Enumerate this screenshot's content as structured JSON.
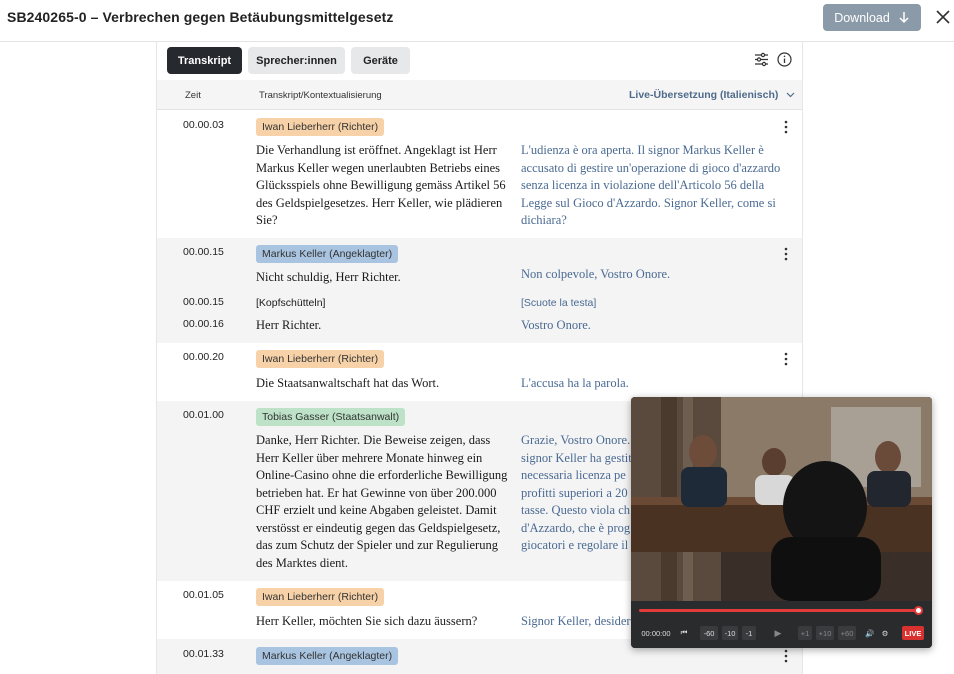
{
  "header": {
    "title": "SB240265-0 – Verbrechen gegen Betäubungsmittelgesetz",
    "download_label": "Download"
  },
  "tabs": [
    {
      "label": "Transkript",
      "active": true
    },
    {
      "label": "Sprecher:innen",
      "active": false
    },
    {
      "label": "Geräte",
      "active": false
    }
  ],
  "columns": {
    "time": "Zeit",
    "transcript": "Transkript/Kontextualisierung",
    "translation": "Live-Übersetzung (Italienisch)"
  },
  "entries": [
    {
      "time": "00.00.03",
      "speaker": "Iwan Lieberherr (Richter)",
      "speaker_color": "#f7d2a8",
      "de": "Die Verhandlung ist eröffnet. Angeklagt ist Herr Markus Keller wegen unerlaubten Betriebs eines Glücksspiels ohne Bewilligung gemäss Artikel 56 des Geldspielgesetzes. Herr Keller, wie plädieren Sie?",
      "it": "L'udienza è ora aperta. Il signor Markus Keller è accusato di gestire un'operazione di gioco d'azzardo senza licenza in violazione dell'Articolo 56 della Legge sul Gioco d'Azzardo. Signor Keller, come si dichiara?"
    },
    {
      "time": "00.00.15",
      "speaker": "Markus Keller (Angeklagter)",
      "speaker_color": "#a9c4e0",
      "de": "Nicht schuldig, Herr Richter.",
      "it": "Non colpevole, Vostro Onore.",
      "sub": [
        {
          "time": "00.00.15",
          "de": "[Kopfschütteln]",
          "it": "[Scuote la testa]"
        },
        {
          "time": "00.00.16",
          "de": "Herr Richter.",
          "it": "Vostro Onore."
        }
      ]
    },
    {
      "time": "00.00.20",
      "speaker": "Iwan Lieberherr (Richter)",
      "speaker_color": "#f7d2a8",
      "de": "Die Staatsanwaltschaft hat das Wort.",
      "it": "L'accusa ha la parola."
    },
    {
      "time": "00.01.00",
      "speaker": "Tobias Gasser (Staatsanwalt)",
      "speaker_color": "#bde2c7",
      "de": "Danke, Herr Richter. Die Beweise zeigen, dass Herr Keller über mehrere Monate hinweg ein Online-Casino ohne die erforderliche Bewilligung betrieben hat. Er hat Gewinne von über 200.000 CHF erzielt und keine Abgaben geleistet. Damit verstösst er eindeutig gegen das Geldspielgesetz, das zum Schutz der Spieler und zur Regulierung des Marktes dient.",
      "it": "Grazie, Vostro Onore. signor Keller ha gestit necessaria licenza pe profitti superiori a 20 tasse. Questo viola ch d'Azzardo, che è prog giocatori e regolare il"
    },
    {
      "time": "00.01.05",
      "speaker": "Iwan Lieberherr (Richter)",
      "speaker_color": "#f7d2a8",
      "de": "Herr Keller, möchten Sie sich dazu äussern?",
      "it": "Signor Keller, desider"
    },
    {
      "time": "00.01.33",
      "speaker": "Markus Keller (Angeklagter)",
      "speaker_color": "#a9c4e0",
      "de": "",
      "it": ""
    }
  ],
  "video": {
    "timecode": "00:00:00",
    "progress": 0.99,
    "buttons": [
      "-60",
      "-10",
      "-1",
      "+1",
      "+10",
      "+60"
    ],
    "live_label": "LIVE"
  },
  "colors": {
    "accent_button": "#8b9aa8",
    "active_tab": "#26292d",
    "translation_text": "#4a6a92",
    "live_red": "#d93030"
  }
}
